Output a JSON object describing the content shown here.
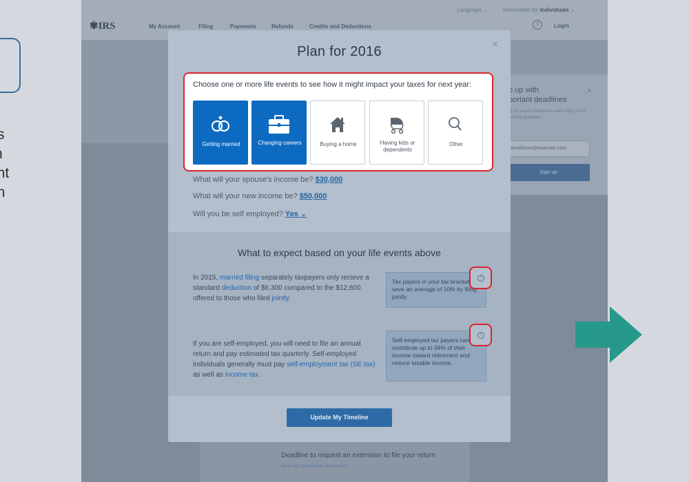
{
  "slide": {
    "side_text": [
      "s",
      "n",
      "ant",
      "on"
    ]
  },
  "site": {
    "logo": "IRS",
    "language": "Language",
    "info_for": "Information for",
    "info_for_value": "Individuals",
    "nav": [
      "My Account",
      "Filing",
      "Payments",
      "Refunds",
      "Credits and Deductions"
    ],
    "login": "Login",
    "signup": {
      "title_line1": "p up with",
      "title_line2": "portant deadlines",
      "sub": "up for email notifications we'll notify you of coming deadlines",
      "email": "anwilliams@example.com",
      "button": "Sign up"
    },
    "deadline": {
      "text": "Deadline to request an extension to file your return",
      "link": "How do I request an extension?"
    }
  },
  "modal": {
    "title": "Plan for 2016",
    "choose_prompt": "Choose one or more life events to see how it might impact your taxes for next year:",
    "tiles": [
      {
        "label": "Getting married",
        "selected": true,
        "icon": "rings-icon"
      },
      {
        "label": "Changing careers",
        "selected": true,
        "icon": "briefcase-icon"
      },
      {
        "label": "Buying a home",
        "selected": false,
        "icon": "house-icon"
      },
      {
        "label": "Having kids or dependents",
        "selected": false,
        "icon": "stroller-icon"
      },
      {
        "label": "Other",
        "selected": false,
        "icon": "magnifier-icon"
      }
    ],
    "questions": [
      {
        "text": "What will your spouse's income be?",
        "answer": "$30,000"
      },
      {
        "text": "What will your new income be?",
        "answer": "$50,000"
      },
      {
        "text": "Will you be self employed?",
        "answer": "Yes"
      }
    ],
    "expect_title": "What to expect based on your life events above",
    "para1": {
      "t1": "In 2015, ",
      "l1": "married filing",
      "t2": " separately taxpayers only recieve a standard ",
      "l2": "deduction",
      "t3": " of $6,300 compared to the $12,600 offered to those who filed ",
      "l3": "jointly",
      "t4": "."
    },
    "tip1": "Tax payers in your tax bracket save an average of 10% by filing jointly",
    "para2": {
      "t1": "If you are self-employed, you will need to file an annual return and pay estimated tax quarterly. Self-employed individuals generally must pay ",
      "l1": "self-employment tax (SE tax)",
      "t2": " as well as ",
      "l2": "income tax",
      "t3": "."
    },
    "tip2": "Self-employed tax payers can contribute up to 34% of their income toward retirement and reduce taxable income.",
    "help_glyph": "?",
    "update_button": "Update My Timeline",
    "close_glyph": "×"
  },
  "colors": {
    "highlight": "#d9262c",
    "selected_tile": "#0d6ac1",
    "arrow": "#26998a"
  }
}
